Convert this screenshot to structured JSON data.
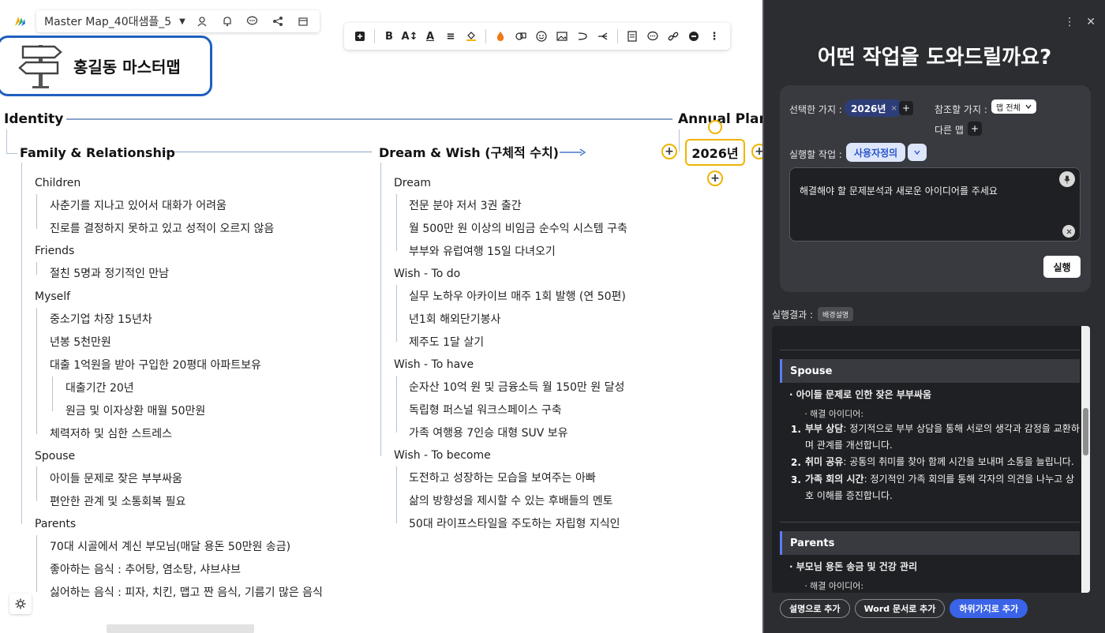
{
  "topbar": {
    "map_title": "Master Map_40대샘플_5",
    "dropdown_glyph": "▼"
  },
  "icons": {
    "app_logo": "app-logo-icon",
    "user": "user-icon",
    "bell": "bell-icon",
    "chat": "chat-icon",
    "share": "share-icon",
    "calendar": "calendar-icon"
  },
  "central": {
    "title": "홍길동 마스터맵"
  },
  "map": {
    "identity": "Identity",
    "annual_plan": "Annual Plan",
    "selected_node": "2026년",
    "family": {
      "title": "Family & Relationship",
      "children": "Children",
      "children_1": "사춘기를 지나고 있어서 대화가 어려움",
      "children_2": "진로를 결정하지 못하고 있고 성적이 오르지 않음",
      "friends": "Friends",
      "friends_1": "절친 5명과 정기적인 만남",
      "myself": "Myself",
      "myself_1": "중소기업 차장 15년차",
      "myself_2": "년봉 5천만원",
      "myself_3": "대출 1억원을 받아 구입한 20평대 아파트보유",
      "myself_3_1": "대출기간 20년",
      "myself_3_2": "원금 및 이자상환 매월 50만원",
      "myself_4": "체력저하 및 심한 스트레스",
      "spouse": "Spouse",
      "spouse_1": "아이들 문제로 잦은 부부싸움",
      "spouse_2": "편안한 관계 및 소통회복 필요",
      "parents": "Parents",
      "parents_1": "70대 시골에서 계신 부모님(매달 용돈 50만원 송금)",
      "parents_2": "좋아하는 음식 : 추어탕, 염소탕, 샤브샤브",
      "parents_3": "싫어하는 음식 : 피자, 치킨, 맵고 짠 음식, 기름기 많은 음식"
    },
    "dream": {
      "title": "Dream & Wish (구체적 수치)",
      "dream": "Dream",
      "dream_1": "전문 분야 저서 3권 출간",
      "dream_2": "월 500만 원 이상의 비임금 순수익 시스템 구축",
      "dream_3": "부부와 유럽여행 15일 다녀오기",
      "todo": "Wish - To do",
      "todo_1": "실무 노하우 아카이브 매주 1회 발행 (연 50편)",
      "todo_2": "년1회 해외단기봉사",
      "todo_3": "제주도 1달 살기",
      "have": "Wish - To have",
      "have_1": "순자산 10억 원 및 금융소득 월 150만 원 달성",
      "have_2": "독립형 퍼스널 워크스페이스 구축",
      "have_3": "가족 여행용 7인승 대형 SUV 보유",
      "become": "Wish - To become",
      "become_1": "도전하고 성장하는 모습을 보여주는 아빠",
      "become_2": "삶의 방향성을 제시할 수 있는 후배들의 멘토",
      "become_3": "50대 라이프스타일을 주도하는 자립형 지식인"
    }
  },
  "panel": {
    "title": "어떤 작업을 도와드릴까요?",
    "selected_branch_label": "선택한 가지 :",
    "selected_branch_chip": "2026년",
    "chip_close": "×",
    "plus": "+",
    "reference_label": "참조할 가지 :",
    "reference_value": "맵 전체",
    "other_map": "다른 맵",
    "task_label": "실행할 작업 :",
    "task_value": "사용자정의",
    "prompt": "해결해야 할 문제분석과 새로운 아이디어를 주세요",
    "run": "실행",
    "result_label": "실행결과 :",
    "result_tag": "배경설명",
    "spouse_head": "Spouse",
    "spouse_issue": "· 아이들 문제로 인한 잦은 부부싸움",
    "idea_label": "ㆍ해결 아이디어:",
    "s1_num": "1.",
    "s1_bold": "부부 상담",
    "s1_text": ": 정기적으로 부부 상담을 통해 서로의 생각과 감정을 교환하며 관계를 개선합니다.",
    "s2_num": "2.",
    "s2_bold": "취미 공유",
    "s2_text": ": 공통의 취미를 찾아 함께 시간을 보내며 소통을 늘립니다.",
    "s3_num": "3.",
    "s3_bold": "가족 회의 시간",
    "s3_text": ": 정기적인 가족 회의를 통해 각자의 의견을 나누고 상호 이해를 증진합니다.",
    "parents_head": "Parents",
    "parents_issue": "· 부모님 용돈 송금 및 건강 관리",
    "btn_add_desc": "설명으로 추가",
    "btn_add_word": "Word 문서로 추가",
    "btn_add_sub": "하위가지로 추가"
  },
  "colors": {
    "central_border": "#1f5fbf",
    "selection": "#f0b400",
    "panel_bg": "#2b2d31",
    "accent": "#3a63e8"
  }
}
